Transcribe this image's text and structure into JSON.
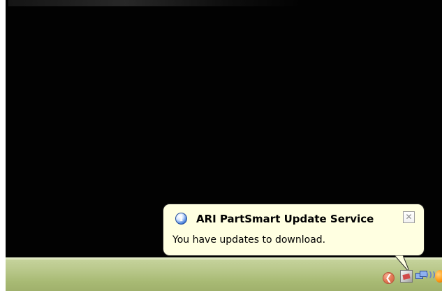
{
  "balloon": {
    "title": "ARI PartSmart Update Service",
    "message": "You have updates to download.",
    "info_icon": "i",
    "close_icon": "✕"
  },
  "taskbar": {
    "tray_expand_icon": "❮",
    "network_icon_waves": ")))"
  },
  "colors": {
    "desktop_background": "#020202",
    "balloon_background": "#ffffe1",
    "taskbar_green": "#b9c88b"
  },
  "icons": {
    "info": "info-icon",
    "close": "close-icon",
    "tray_expand": "chevron-left-icon",
    "tray_app": "app-icon",
    "network": "network-icon",
    "orange_tray": "orange-tray-icon"
  }
}
